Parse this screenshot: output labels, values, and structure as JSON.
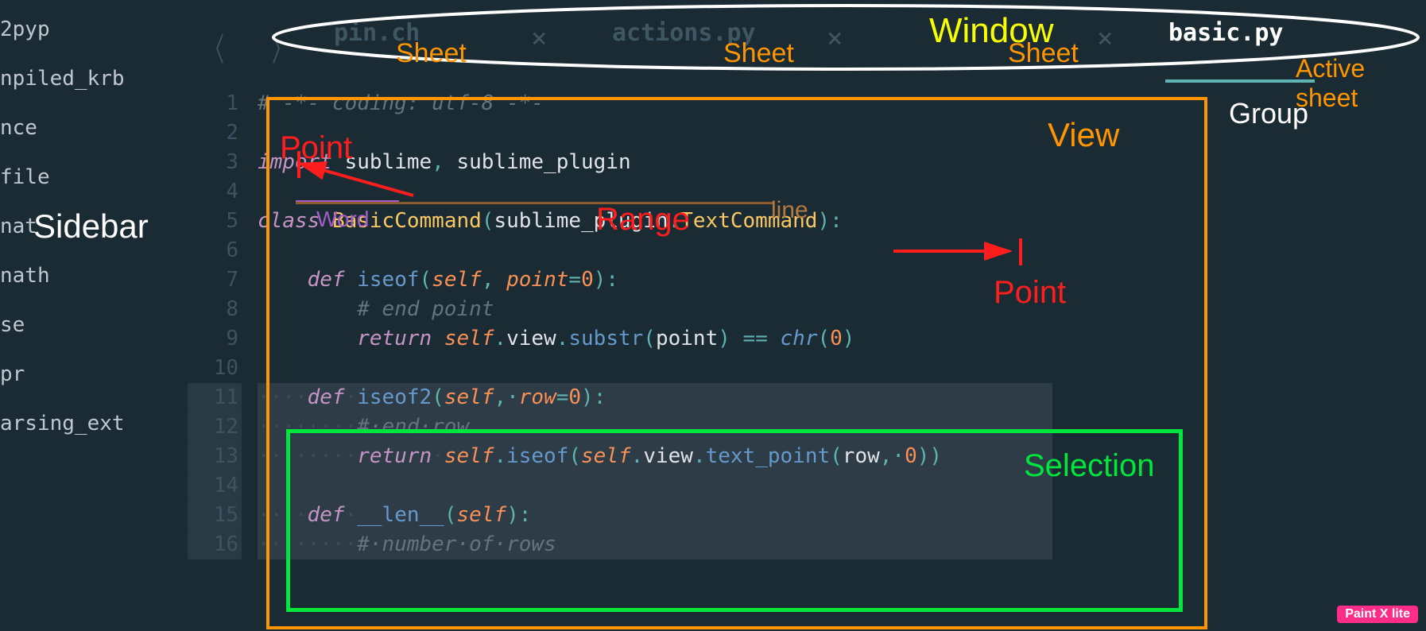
{
  "sidebar": {
    "label": "Sidebar",
    "items": [
      "2pyp",
      "npiled_krb",
      "nce",
      "file",
      "nat",
      "nath",
      "se",
      "pr",
      "arsing_ext"
    ]
  },
  "tabs": {
    "window_label": "Window",
    "active_sheet_label": "Active sheet",
    "sheet_label_0": "Sheet",
    "sheet_label_1": "Sheet",
    "sheet_label_2": "Sheet",
    "items": [
      {
        "name": "pin.ch"
      },
      {
        "name": "actions.py"
      },
      {
        "name": ""
      },
      {
        "name": "basic.py",
        "active": true
      }
    ]
  },
  "gutter": {
    "start": 1,
    "end": 16,
    "highlighted": [
      11,
      12,
      13,
      14,
      15,
      16
    ]
  },
  "code": {
    "lines": [
      [
        [
          "c-comment",
          "# -*- coding: utf-8 -*-"
        ]
      ],
      [],
      [
        [
          "c-kw",
          "import"
        ],
        [
          "",
          " "
        ],
        [
          "c-var",
          "sublime"
        ],
        [
          "c-punct",
          ", "
        ],
        [
          "c-var",
          "sublime_plugin"
        ]
      ],
      [],
      [
        [
          "c-kw",
          "class"
        ],
        [
          "",
          " "
        ],
        [
          "c-class",
          "BasicCommand"
        ],
        [
          "c-punct",
          "("
        ],
        [
          "c-var",
          "sublime_plugin"
        ],
        [
          "c-punct",
          "."
        ],
        [
          "c-class",
          "TextCommand"
        ],
        [
          "c-punct",
          "):"
        ]
      ],
      [],
      [
        [
          "",
          "    "
        ],
        [
          "c-kw",
          "def"
        ],
        [
          "",
          " "
        ],
        [
          "c-func",
          "iseof"
        ],
        [
          "c-punct",
          "("
        ],
        [
          "c-param",
          "self"
        ],
        [
          "c-punct",
          ", "
        ],
        [
          "c-param",
          "point"
        ],
        [
          "c-punct",
          "="
        ],
        [
          "c-num",
          "0"
        ],
        [
          "c-punct",
          "):"
        ]
      ],
      [
        [
          "",
          "        "
        ],
        [
          "c-comment",
          "# end point"
        ]
      ],
      [
        [
          "",
          "        "
        ],
        [
          "c-kw",
          "return"
        ],
        [
          "",
          " "
        ],
        [
          "c-param",
          "self"
        ],
        [
          "c-punct",
          "."
        ],
        [
          "c-var",
          "view"
        ],
        [
          "c-punct",
          "."
        ],
        [
          "c-func",
          "substr"
        ],
        [
          "c-punct",
          "("
        ],
        [
          "c-var",
          "point"
        ],
        [
          "c-punct",
          ") "
        ],
        [
          "c-punct",
          "== "
        ],
        [
          "c-builtin",
          "chr"
        ],
        [
          "c-punct",
          "("
        ],
        [
          "c-num",
          "0"
        ],
        [
          "c-punct",
          ")"
        ]
      ],
      [],
      [
        [
          "c-ws-dot",
          "····"
        ],
        [
          "c-kw",
          "def"
        ],
        [
          "c-ws-dot",
          "·"
        ],
        [
          "c-func",
          "iseof2"
        ],
        [
          "c-punct",
          "("
        ],
        [
          "c-param",
          "self"
        ],
        [
          "c-punct",
          ",·"
        ],
        [
          "c-param",
          "row"
        ],
        [
          "c-punct",
          "="
        ],
        [
          "c-num",
          "0"
        ],
        [
          "c-punct",
          "):"
        ]
      ],
      [
        [
          "c-ws-dot",
          "········"
        ],
        [
          "c-comment",
          "#·end·row"
        ]
      ],
      [
        [
          "c-ws-dot",
          "········"
        ],
        [
          "c-kw",
          "return"
        ],
        [
          "c-ws-dot",
          "·"
        ],
        [
          "c-param",
          "self"
        ],
        [
          "c-punct",
          "."
        ],
        [
          "c-func",
          "iseof"
        ],
        [
          "c-punct",
          "("
        ],
        [
          "c-param",
          "self"
        ],
        [
          "c-punct",
          "."
        ],
        [
          "c-var",
          "view"
        ],
        [
          "c-punct",
          "."
        ],
        [
          "c-func",
          "text_point"
        ],
        [
          "c-punct",
          "("
        ],
        [
          "c-var",
          "row"
        ],
        [
          "c-punct",
          ",·"
        ],
        [
          "c-num",
          "0"
        ],
        [
          "c-punct",
          "))"
        ]
      ],
      [],
      [
        [
          "c-ws-dot",
          "····"
        ],
        [
          "c-kw",
          "def"
        ],
        [
          "c-ws-dot",
          "·"
        ],
        [
          "c-func",
          "__len__"
        ],
        [
          "c-punct",
          "("
        ],
        [
          "c-param",
          "self"
        ],
        [
          "c-punct",
          "):"
        ]
      ],
      [
        [
          "c-ws-dot",
          "········"
        ],
        [
          "c-comment",
          "#·number·of·rows"
        ]
      ]
    ],
    "selection_rows": [
      11,
      12,
      13,
      14,
      15,
      16
    ]
  },
  "annotations": {
    "window": "Window",
    "sheet": "Sheet",
    "active_sheet": "Active sheet",
    "group": "Group",
    "view": "View",
    "point": "Point",
    "word": "Word",
    "range": "Range",
    "line": "line",
    "selection": "Selection",
    "sidebar": "Sidebar"
  },
  "watermark": "Paint X lite"
}
